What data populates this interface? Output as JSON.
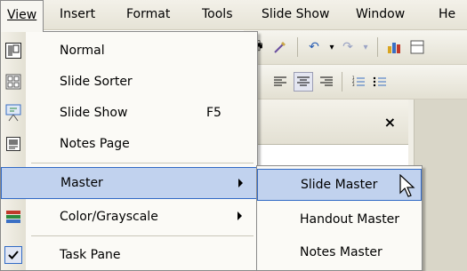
{
  "menubar": {
    "items": [
      {
        "label": "View",
        "state": "open"
      },
      {
        "label": "Insert"
      },
      {
        "label": "Format"
      },
      {
        "label": "Tools"
      },
      {
        "label": "Slide Show"
      },
      {
        "label": "Window"
      },
      {
        "label": "He"
      }
    ]
  },
  "view_menu": {
    "items": [
      {
        "label": "Normal",
        "icon": "normal-view-icon"
      },
      {
        "label": "Slide Sorter",
        "icon": "slide-sorter-icon"
      },
      {
        "label": "Slide Show",
        "icon": "slide-show-icon",
        "shortcut": "F5"
      },
      {
        "label": "Notes Page",
        "icon": "notes-page-icon"
      },
      {
        "label": "Master",
        "state": "highlighted",
        "has_submenu": true
      },
      {
        "label": "Color/Grayscale",
        "icon": "color-grayscale-icon",
        "has_submenu": true
      },
      {
        "label": "Task Pane",
        "icon": "checkmark-icon",
        "checked": true
      }
    ]
  },
  "master_submenu": {
    "items": [
      {
        "label": "Slide Master",
        "state": "highlighted"
      },
      {
        "label": "Handout Master"
      },
      {
        "label": "Notes Master"
      }
    ]
  },
  "task_pane": {
    "close_label": "×"
  },
  "colors": {
    "highlight": "#c1d2ee",
    "highlight_border": "#316ac5",
    "menu_bg": "#fbfaf6"
  }
}
